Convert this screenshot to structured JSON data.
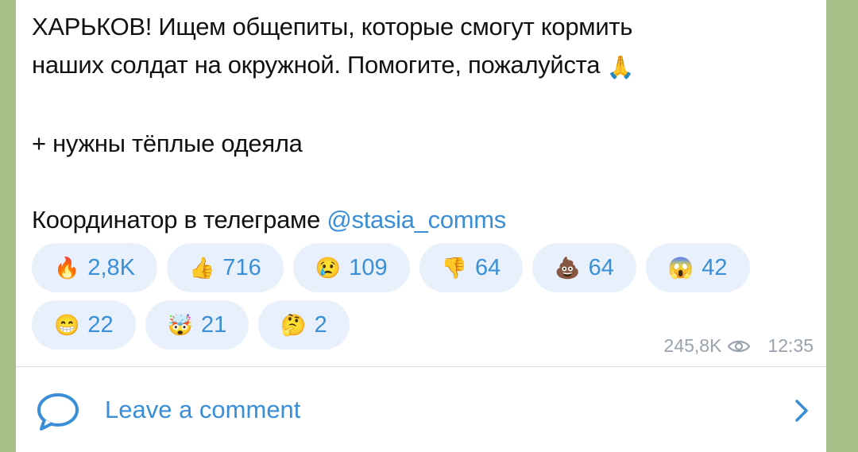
{
  "message": {
    "line1": "ХАРЬКОВ! Ищем общепиты, которые смогут кормить",
    "line2": "наших солдат на окружной. Помогите, пожалуйста",
    "line2_emoji": "🙏",
    "line3": "+ нужны тёплые одеяла",
    "line4_prefix": "Координатор в телеграме ",
    "mention": "@stasia_comms"
  },
  "reactions": {
    "row1": [
      {
        "emoji": "🔥",
        "count": "2,8K"
      },
      {
        "emoji": "👍",
        "count": "716"
      },
      {
        "emoji": "😢",
        "count": "109"
      },
      {
        "emoji": "👎",
        "count": "64"
      },
      {
        "emoji": "💩",
        "count": "64"
      },
      {
        "emoji": "😱",
        "count": "42"
      }
    ],
    "row2": [
      {
        "emoji": "😁",
        "count": "22"
      },
      {
        "emoji": "🤯",
        "count": "21"
      },
      {
        "emoji": "🤔",
        "count": "2"
      }
    ]
  },
  "meta": {
    "views": "245,8K",
    "time": "12:35"
  },
  "comment": {
    "label": "Leave a comment"
  },
  "colors": {
    "accent": "#3a8ed6",
    "reaction_bg": "#e8f1fb",
    "background": "#a9bf8a"
  }
}
